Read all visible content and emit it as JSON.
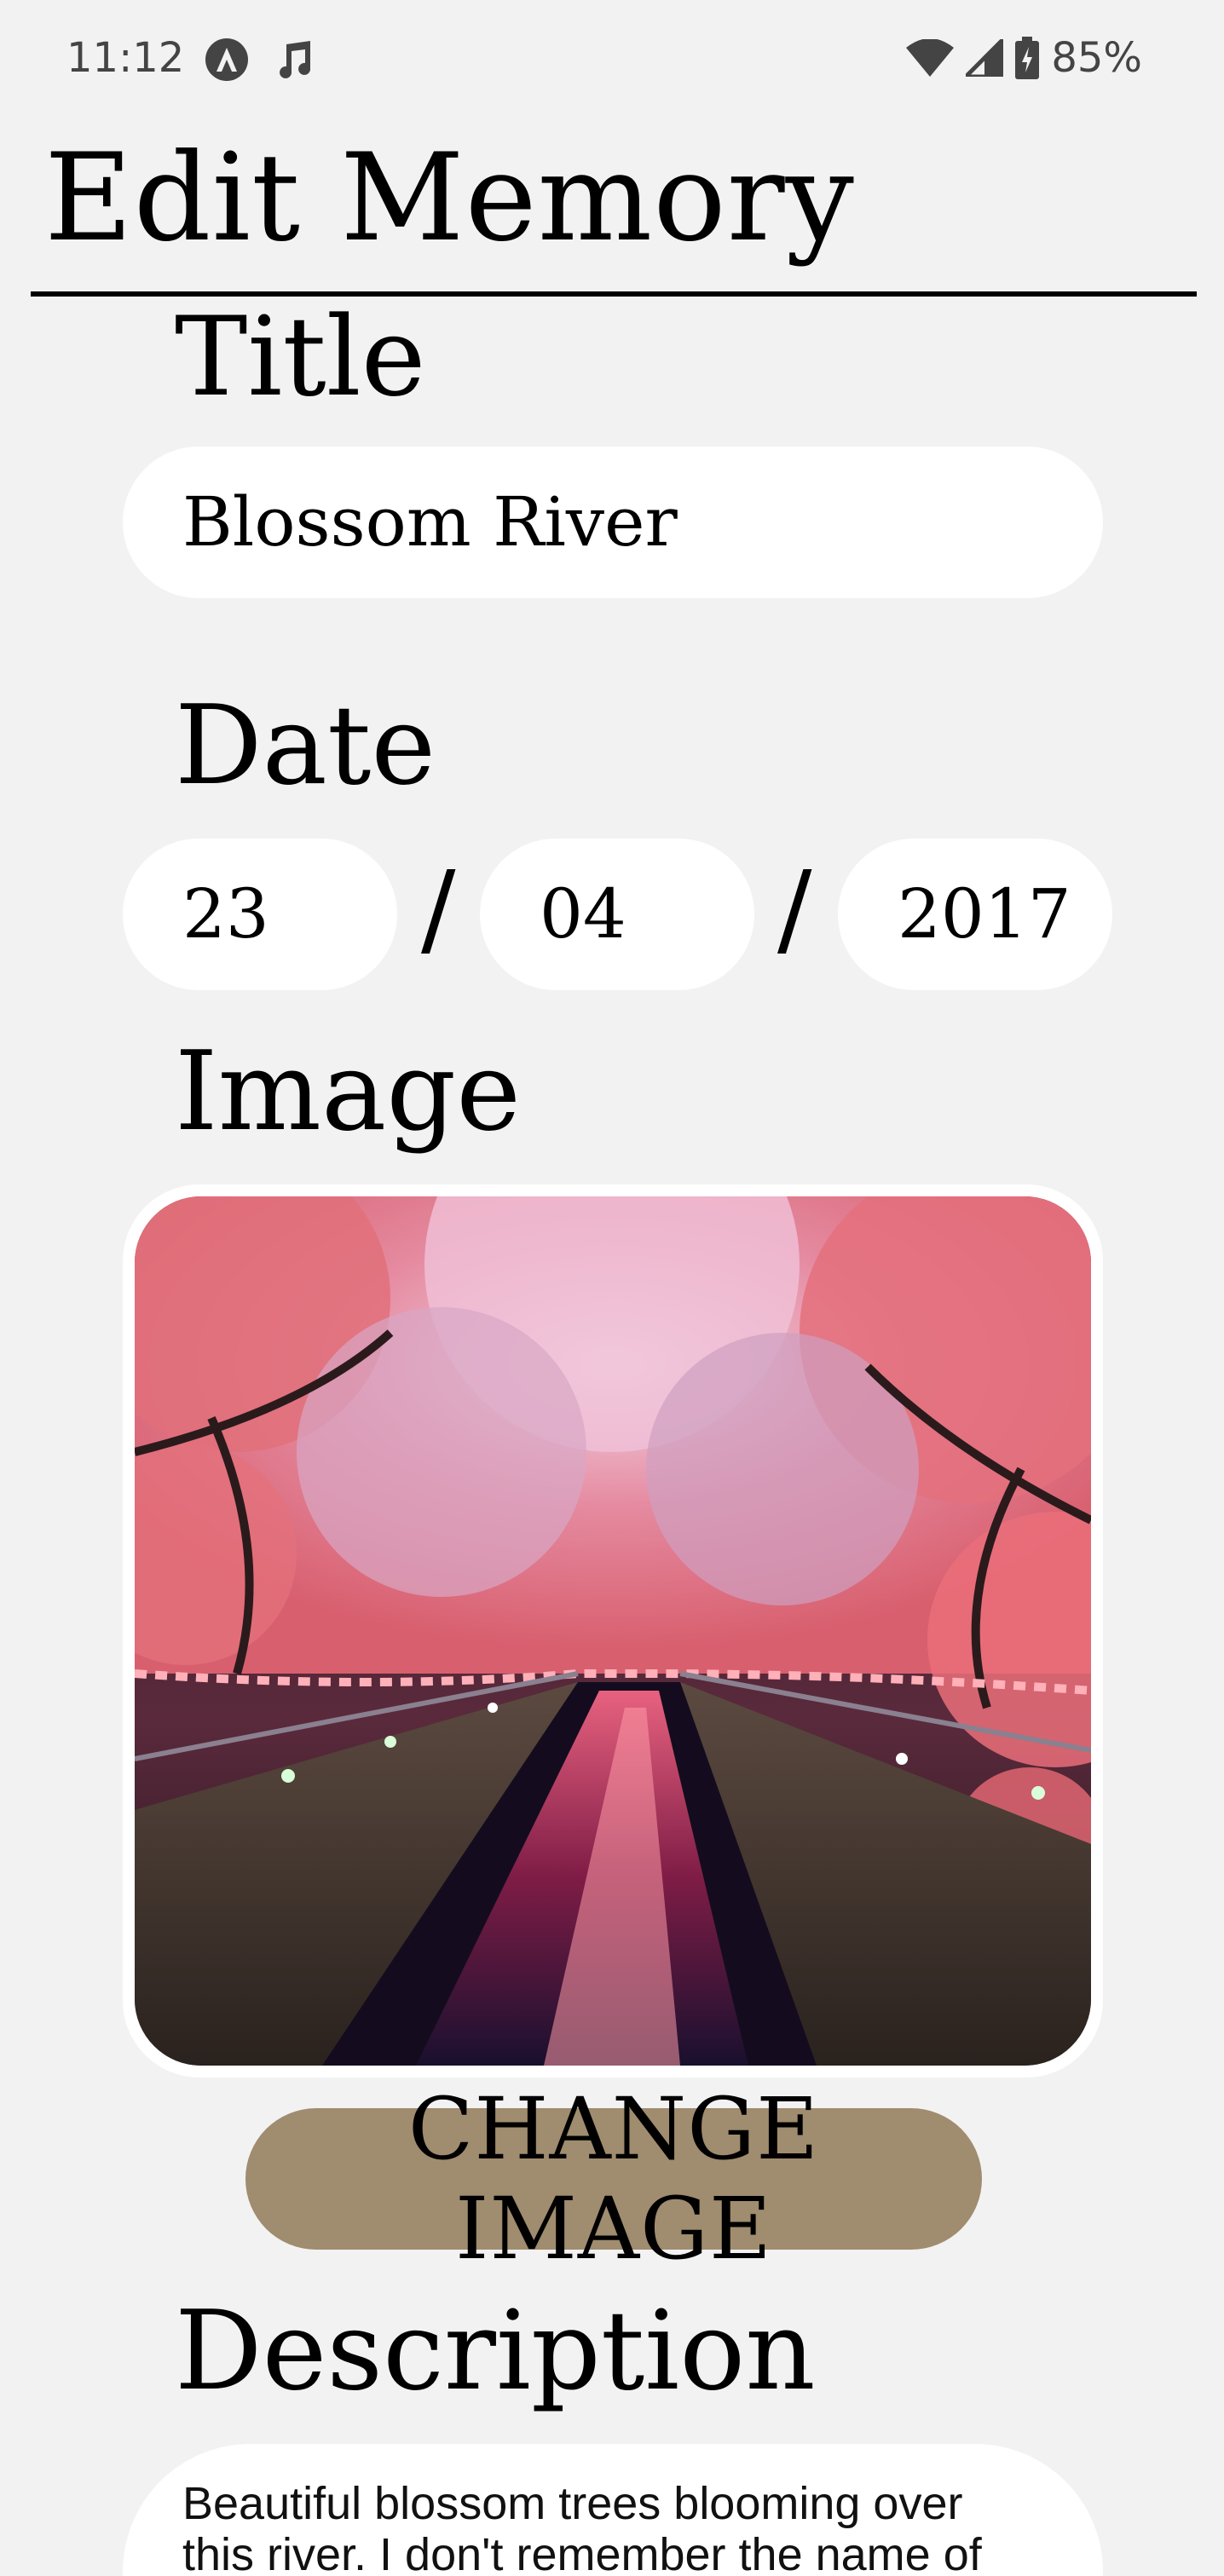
{
  "status_bar": {
    "time": "11:12",
    "battery": "85%",
    "icons": [
      "android-auto-icon",
      "music-note-icon",
      "wifi-icon",
      "cell-signal-icon",
      "battery-charging-icon"
    ]
  },
  "header": {
    "title": "Edit Memory"
  },
  "form": {
    "title_label": "Title",
    "title_value": "Blossom River",
    "date_label": "Date",
    "day": "23",
    "month": "04",
    "year": "2017",
    "separator": "/",
    "image_label": "Image",
    "change_image_label": "CHANGE IMAGE",
    "description_label": "Description",
    "description_value": "Beautiful blossom trees blooming over this river. I don't remember the name of"
  },
  "colors": {
    "background": "#f2f2f2",
    "field": "#ffffff",
    "button": "#a08c6e",
    "text": "#000000"
  }
}
